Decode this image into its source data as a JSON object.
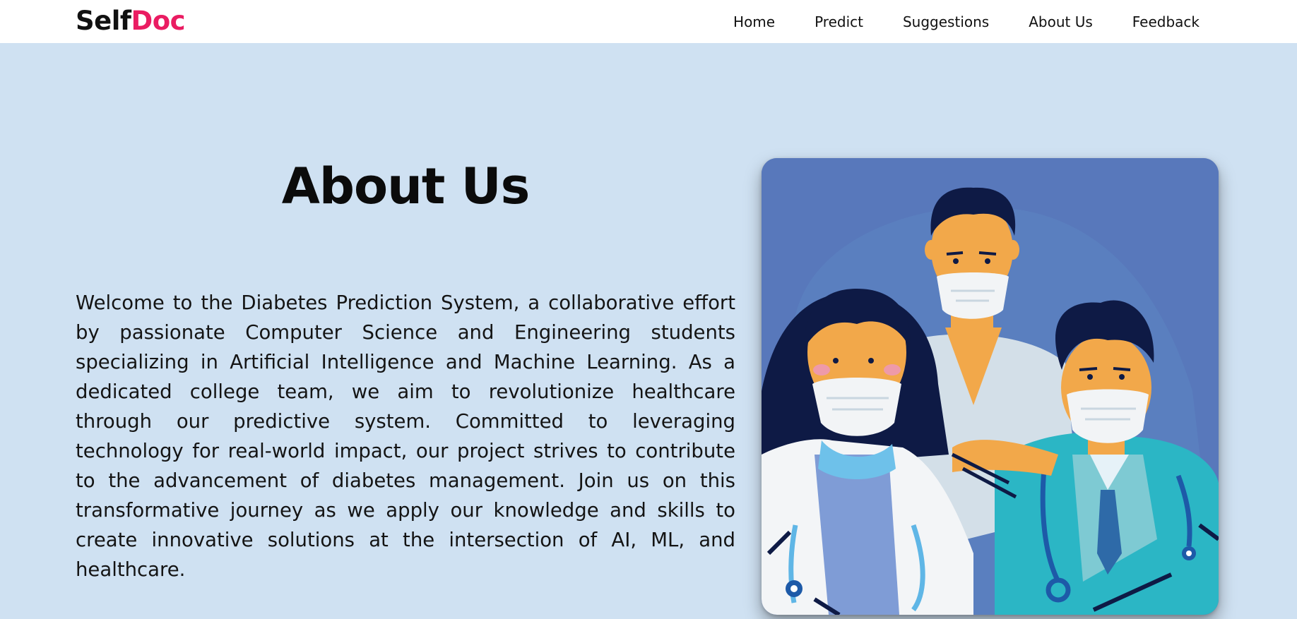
{
  "brand": {
    "part1": "Self",
    "part2": "Doc",
    "accent_color": "#ea1c62"
  },
  "nav": {
    "items": [
      {
        "label": "Home"
      },
      {
        "label": "Predict"
      },
      {
        "label": "Suggestions"
      },
      {
        "label": "About Us"
      },
      {
        "label": "Feedback"
      }
    ]
  },
  "about": {
    "title": "About Us",
    "body": "Welcome to the Diabetes Prediction System, a collaborative effort by passionate Computer Science and Engineering students specializing in Artificial Intelligence and Machine Learning. As a dedicated college team, we aim to revolutionize healthcare through our predictive system. Committed to leveraging technology for real-world impact, our project strives to contribute to the advancement of diabetes management. Join us on this transformative journey as we apply our knowledge and skills to create innovative solutions at the intersection of AI, ML, and healthcare."
  },
  "illustration": {
    "subject": "medical-team-illustration",
    "background_color": "#5878bb"
  },
  "colors": {
    "page_background": "#cfe1f2",
    "navbar_background": "#ffffff",
    "text": "#111111"
  }
}
